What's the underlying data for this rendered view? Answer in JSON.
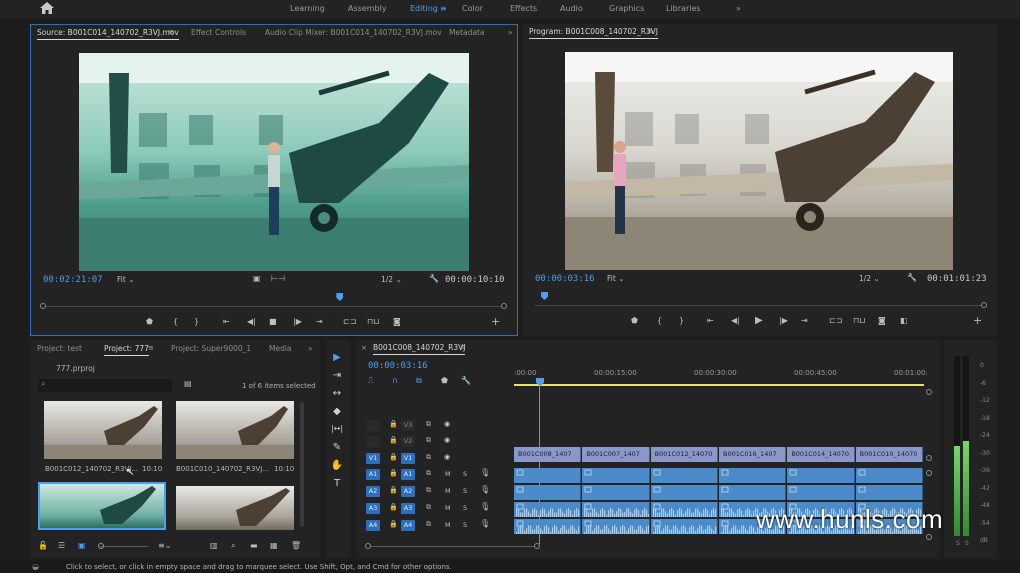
{
  "workspaces": {
    "home_icon": "home-icon",
    "items": [
      "Learning",
      "Assembly",
      "Editing",
      "Color",
      "Effects",
      "Audio",
      "Graphics",
      "Libraries"
    ],
    "more": "»"
  },
  "source_monitor": {
    "tabs": [
      "Source: B001C014_140702_R3VJ.mov",
      "Effect Controls",
      "Audio Clip Mixer: B001C014_140702_R3VJ.mov",
      "Metadata"
    ],
    "more": "»",
    "timecode": "00:02:21:07",
    "zoom": "Fit",
    "resolution": "1/2",
    "duration": "00:00:10:10",
    "playhead_fraction": 0.64
  },
  "program_monitor": {
    "title": "Program: B001C008_140702_R3VJ",
    "timecode": "00:00:03:16",
    "zoom": "Fit",
    "resolution": "1/2",
    "duration": "00:01:01:23",
    "playhead_fraction": 0.02
  },
  "project_panel": {
    "tabs": [
      "Project: test",
      "Project: 777",
      "Project: Super9000_1",
      "Media"
    ],
    "more": "»",
    "file": "777.prproj",
    "search_placeholder": "",
    "selection_status": "1 of 6 items selected",
    "clips": [
      {
        "name": "B001C012_140702_R3VJ...",
        "duration": "10:10"
      },
      {
        "name": "B001C010_140702_R3VJ...",
        "duration": "10:10"
      },
      {
        "name": "",
        "duration": ""
      },
      {
        "name": "",
        "duration": ""
      }
    ]
  },
  "tools": [
    "▶",
    "⇥",
    "↔",
    "◆",
    "|↔|",
    "✎",
    "✋",
    "T"
  ],
  "timeline": {
    "sequence_tab": "B001C008_140702_R3VJ",
    "timecode": "00:00:03:16",
    "ruler": [
      ":00:00",
      "00:00:15:00",
      "00:00:30:00",
      "00:00:45:00",
      "00:01:00:"
    ],
    "video_tracks": [
      {
        "src": "",
        "name": "V3"
      },
      {
        "src": "",
        "name": "V2"
      },
      {
        "src": "V1",
        "name": "V1"
      }
    ],
    "audio_tracks": [
      {
        "src": "A1",
        "name": "A1"
      },
      {
        "src": "A2",
        "name": "A2"
      },
      {
        "src": "A3",
        "name": "A3"
      },
      {
        "src": "A4",
        "name": "A4"
      }
    ],
    "mute_label": "M",
    "solo_label": "S",
    "video_clips": [
      "B001C008_1407",
      "B001C007_1407",
      "B001C012_14070",
      "B001C016_1407",
      "B001C014_14070",
      "B001C010_14070"
    ]
  },
  "audio_meter": {
    "scale": [
      "0",
      "-6",
      "-12",
      "-18",
      "-24",
      "-30",
      "-36",
      "-42",
      "-48",
      "-54",
      "dB"
    ]
  },
  "status_bar": "Click to select, or click in empty space and drag to marquee select. Use Shift, Opt, and Cmd for other options.",
  "watermark": "www.hunls.com",
  "colors": {
    "accent": "#4d9df0",
    "track_enabled": "#2d6fbf",
    "video_clip": "#8a98c9",
    "audio_clip": "#4b8bc9",
    "panel_bg": "#232323"
  }
}
